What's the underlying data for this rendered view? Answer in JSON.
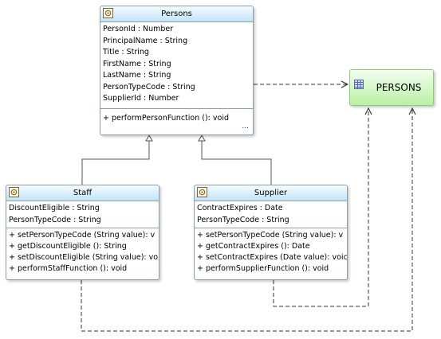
{
  "classes": {
    "persons": {
      "name": "Persons",
      "attributes": [
        "PersonId : Number",
        "PrincipalName : String",
        "Title : String",
        "FirstName : String",
        "LastName : String",
        "PersonTypeCode : String",
        "SupplierId : Number"
      ],
      "operations": [
        "+ performPersonFunction (): void"
      ],
      "more": "..."
    },
    "staff": {
      "name": "Staff",
      "attributes": [
        "DiscountEligible : String",
        "PersonTypeCode : String"
      ],
      "operations": [
        "+ setPersonTypeCode (String value): v",
        "+ getDiscountEligible (): String",
        "+ setDiscountEligible (String value): voi",
        "+ performStaffFunction (): void"
      ],
      "more": "..."
    },
    "supplier": {
      "name": "Supplier",
      "attributes": [
        "ContractExpires : Date",
        "PersonTypeCode : String"
      ],
      "operations": [
        "+ setPersonTypeCode (String value): v",
        "+ getContractExpires (): Date",
        "+ setContractExpires (Date value): voic",
        "+ performSupplierFunction (): void"
      ],
      "more": "..."
    }
  },
  "table": {
    "name": "PERSONS"
  },
  "icons": {
    "class_icon": "class-icon",
    "table_icon": "table-icon"
  },
  "colors": {
    "class_header": "#c3e4f7",
    "class_border": "#8a9db3",
    "table_fill": "#b9efa4",
    "table_border": "#88cf6f",
    "connector": "#333333"
  }
}
